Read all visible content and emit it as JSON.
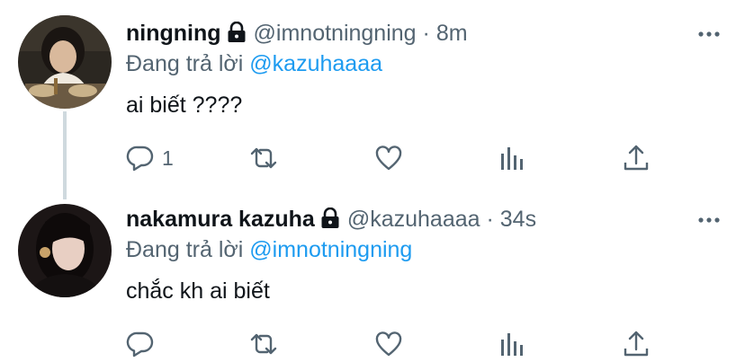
{
  "colors": {
    "text": "#0f1419",
    "secondary": "#536471",
    "link": "#1d9bf0",
    "thread_line": "#cfd9de"
  },
  "tweets": [
    {
      "name": "ningning",
      "protected_icon": "lock-icon",
      "handle": "@imnotningning",
      "separator": "·",
      "time": "8m",
      "replying_prefix": "Đang trả lời",
      "replying_to": "@kazuhaaaa",
      "text": "ai biết ????",
      "reply_count": "1",
      "icons": [
        "reply-icon",
        "retweet-icon",
        "like-icon",
        "analytics-icon",
        "share-icon",
        "more-icon"
      ]
    },
    {
      "name": "nakamura kazuha",
      "protected_icon": "lock-icon",
      "handle": "@kazuhaaaa",
      "separator": "·",
      "time": "34s",
      "replying_prefix": "Đang trả lời",
      "replying_to": "@imnotningning",
      "text": "chắc kh ai biết",
      "reply_count": "",
      "icons": [
        "reply-icon",
        "retweet-icon",
        "like-icon",
        "analytics-icon",
        "share-icon",
        "more-icon"
      ]
    }
  ]
}
